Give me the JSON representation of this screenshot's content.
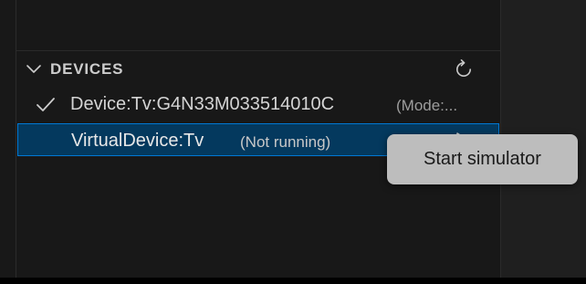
{
  "devices_section": {
    "title": "DEVICES",
    "collapse_icon": "chevron-down-icon",
    "refresh_icon": "refresh-icon"
  },
  "devices": [
    {
      "label": "Device:Tv:G4N33M033514010C",
      "description": "(Mode:...",
      "selected_check": true,
      "icon": "check-icon"
    },
    {
      "label": "VirtualDevice:Tv",
      "description": "(Not running)",
      "focused": true,
      "action_icon": "play-icon"
    }
  ],
  "tooltip": {
    "text": "Start simulator"
  },
  "colors": {
    "background": "#181818",
    "selection_bg": "#04395e",
    "selection_border": "#0078d4",
    "tooltip_bg": "#bdbdbd"
  }
}
